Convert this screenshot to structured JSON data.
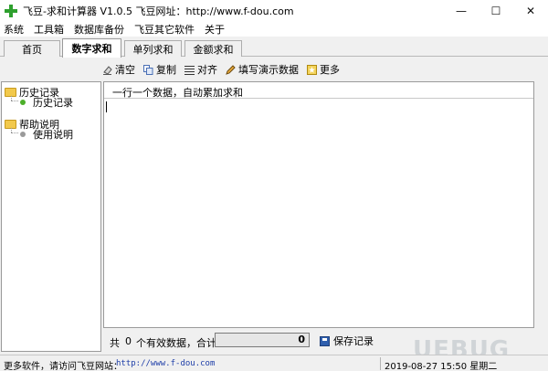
{
  "window": {
    "title": "飞豆-求和计算器 V1.0.5   飞豆网址：http://www.f-dou.com",
    "controls": {
      "minimize": "—",
      "maximize": "☐",
      "close": "✕"
    }
  },
  "menu": [
    "系统",
    "工具箱",
    "数据库备份",
    "飞豆其它软件",
    "关于"
  ],
  "tabs": [
    {
      "label": "首页",
      "active": false
    },
    {
      "label": "数字求和",
      "active": true
    },
    {
      "label": "单列求和",
      "active": false
    },
    {
      "label": "金额求和",
      "active": false
    }
  ],
  "toolbar": {
    "clear": "清空",
    "copy": "复制",
    "align": "对齐",
    "fill_demo": "填写演示数据",
    "more": "更多"
  },
  "tree": {
    "history": {
      "label": "历史记录",
      "child": "历史记录"
    },
    "help": {
      "label": "帮助说明",
      "child": "使用说明"
    }
  },
  "editor": {
    "hint": "一行一个数据，自动累加求和",
    "content": ""
  },
  "summary": {
    "prefix": "共",
    "count": "0",
    "suffix": "个有效数据，合计：",
    "total": "0",
    "save_label": "保存记录"
  },
  "status": {
    "message": "更多软件，请访问飞豆网站：",
    "url": "http://www.f-dou.com",
    "datetime": "2019-08-27 15:50 星期二"
  },
  "watermark": "UEBUG",
  "colors": {
    "history_dot": "#4caf2a",
    "help_dot": "#9a9a9a",
    "link": "#1e3ea8",
    "accent_green": "#2ea02e"
  }
}
